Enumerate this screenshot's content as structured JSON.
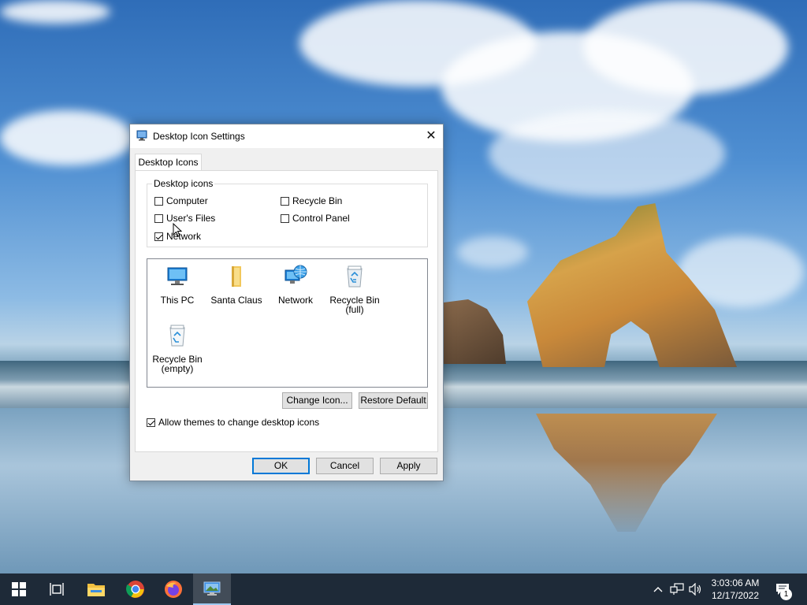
{
  "dialog": {
    "title": "Desktop Icon Settings",
    "close_glyph": "✕",
    "tab_label": "Desktop Icons",
    "group_label": "Desktop icons",
    "checkboxes": [
      {
        "label": "Computer",
        "checked": false
      },
      {
        "label": "Recycle Bin",
        "checked": false
      },
      {
        "label": "User's Files",
        "checked": false
      },
      {
        "label": "Control Panel",
        "checked": false
      },
      {
        "label": "Network",
        "checked": true
      }
    ],
    "icons": [
      {
        "label": "This PC",
        "icon": "monitor-icon"
      },
      {
        "label": "Santa Claus",
        "icon": "folder-icon"
      },
      {
        "label": "Network",
        "icon": "network-globe-icon"
      },
      {
        "label": "Recycle Bin\n(full)",
        "label_l1": "Recycle Bin",
        "label_l2": "(full)",
        "icon": "recycle-bin-full-icon"
      },
      {
        "label": "Recycle Bin\n(empty)",
        "label_l1": "Recycle Bin",
        "label_l2": "(empty)",
        "icon": "recycle-bin-empty-icon"
      }
    ],
    "change_icon_label": "Change Icon...",
    "restore_default_label": "Restore Default",
    "allow_themes_label": "Allow themes to change desktop icons",
    "allow_themes_checked": true,
    "ok_label": "OK",
    "cancel_label": "Cancel",
    "apply_label": "Apply"
  },
  "taskbar": {
    "apps": [
      "start-icon",
      "task-view-icon",
      "file-explorer-icon",
      "chrome-icon",
      "firefox-icon",
      "desktop-icon-settings-app-icon"
    ],
    "clock_time": "3:03:06 AM",
    "clock_date": "12/17/2022",
    "notification_count": "1"
  },
  "colors": {
    "taskbar": "#1e2a38",
    "accent": "#0078d7",
    "dialog_bg": "#f0f0f0"
  }
}
